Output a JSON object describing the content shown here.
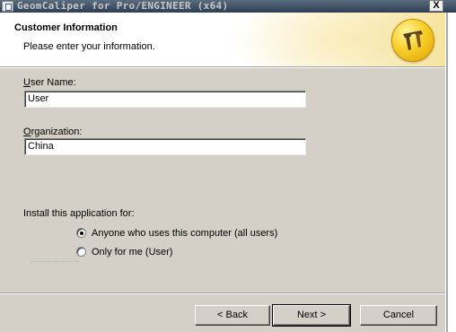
{
  "window": {
    "title": "GeomCaliper for Pro/ENGINEER (x64)",
    "close_label": "X"
  },
  "header": {
    "title": "Customer Information",
    "subtitle": "Please enter your information.",
    "logo_icon": "caliper-icon"
  },
  "form": {
    "user_name": {
      "label_key": "U",
      "label_rest": "ser Name:",
      "value": "User"
    },
    "organization": {
      "label_key": "O",
      "label_rest": "rganization:",
      "value": "China"
    }
  },
  "install_for": {
    "label": "Install this application for:",
    "options": [
      {
        "label": "Anyone who uses this computer (all users)",
        "selected": true
      },
      {
        "label": "Only for me (User)",
        "selected": false
      }
    ]
  },
  "buttons": {
    "back": "< Back",
    "next": "Next >",
    "cancel": "Cancel"
  },
  "colors": {
    "dialog_bg": "#d4d0c8",
    "title_bar": "#2e3e54",
    "logo_gold": "#f7cf2a"
  }
}
